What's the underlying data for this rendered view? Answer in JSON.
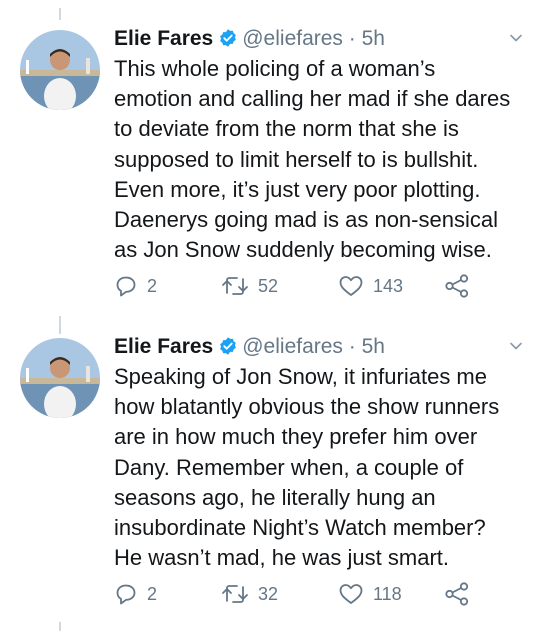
{
  "tweets": [
    {
      "name": "Elie Fares",
      "handle": "@eliefares",
      "separator": "·",
      "time": "5h",
      "lines": [
        "This whole policing of a woman’s",
        "emotion and calling her mad if she dares",
        "to deviate from the norm that she is",
        "supposed to limit herself to is bullshit.",
        "Even more, it’s just very poor plotting.",
        "Daenerys going mad is as non-sensical",
        "as Jon Snow suddenly becoming wise."
      ],
      "replies": "2",
      "retweets": "52",
      "likes": "143"
    },
    {
      "name": "Elie Fares",
      "handle": "@eliefares",
      "separator": "·",
      "time": "5h",
      "lines": [
        "Speaking of Jon Snow, it infuriates me",
        "how blatantly obvious the show runners",
        "are in how much they prefer him over",
        "Dany. Remember when, a couple of",
        "seasons ago, he literally hung an",
        "insubordinate Night’s Watch member?",
        "He wasn’t mad, he was just smart."
      ],
      "replies": "2",
      "retweets": "32",
      "likes": "118"
    }
  ],
  "icons": {
    "verified": "verified-badge-icon",
    "menu": "chevron-down-icon",
    "reply": "reply-icon",
    "retweet": "retweet-icon",
    "like": "heart-icon",
    "share": "share-icon"
  },
  "colors": {
    "verified": "#1da1f2",
    "secondary_text": "#657786",
    "thread_line": "#cfd9de"
  }
}
